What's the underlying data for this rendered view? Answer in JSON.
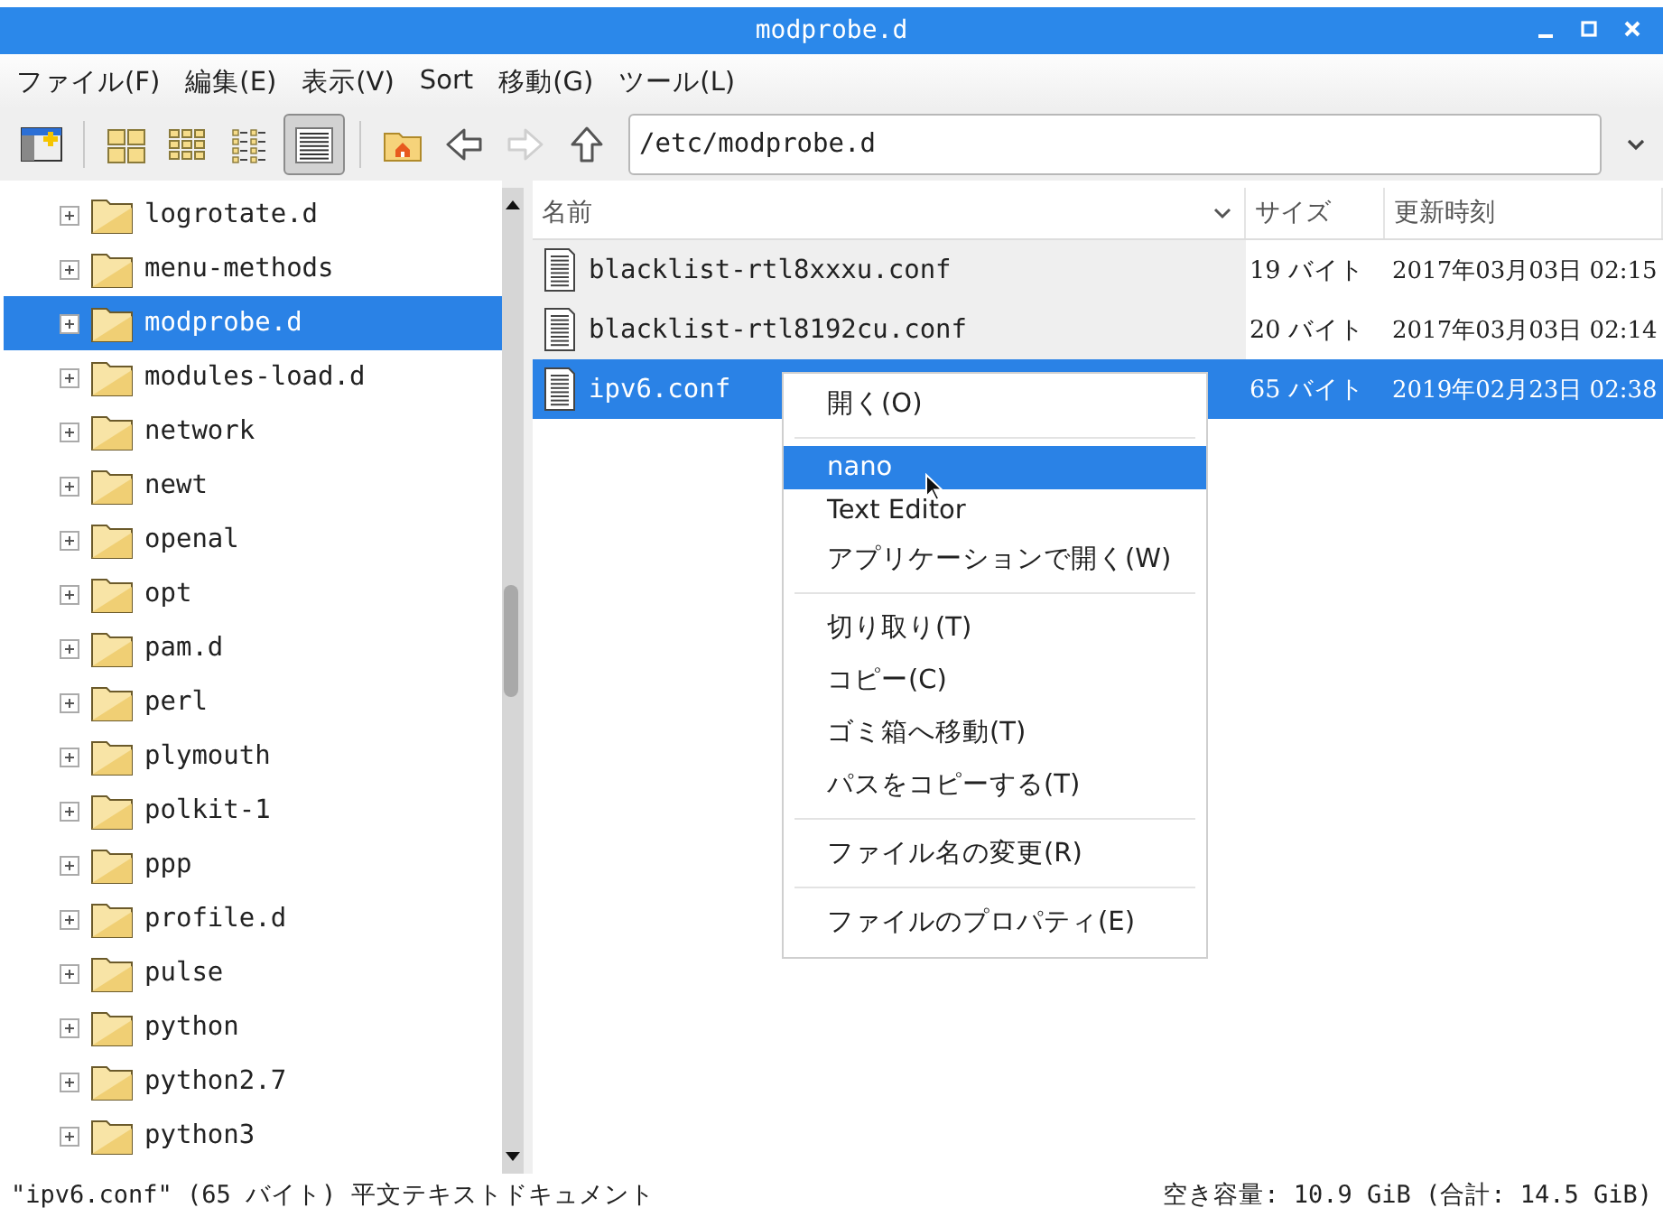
{
  "window": {
    "title": "modprobe.d"
  },
  "menu_bar": [
    "ファイル(F)",
    "編集(E)",
    "表示(V)",
    "Sort",
    "移動(G)",
    "ツール(L)"
  ],
  "toolbar": {
    "view_buttons": [
      {
        "kind": "icons",
        "selected": false
      },
      {
        "kind": "thumbnails",
        "selected": false
      },
      {
        "kind": "compact",
        "selected": false
      },
      {
        "kind": "detailed",
        "selected": true
      }
    ],
    "nav_buttons": [
      {
        "kind": "home",
        "disabled": false
      },
      {
        "kind": "back",
        "disabled": false
      },
      {
        "kind": "forward",
        "disabled": true
      },
      {
        "kind": "up",
        "disabled": false
      }
    ],
    "path": "/etc/modprobe.d"
  },
  "sidebar": {
    "items": [
      {
        "label": "logrotate.d",
        "selected": false
      },
      {
        "label": "menu-methods",
        "selected": false
      },
      {
        "label": "modprobe.d",
        "selected": true
      },
      {
        "label": "modules-load.d",
        "selected": false
      },
      {
        "label": "network",
        "selected": false
      },
      {
        "label": "newt",
        "selected": false
      },
      {
        "label": "openal",
        "selected": false
      },
      {
        "label": "opt",
        "selected": false
      },
      {
        "label": "pam.d",
        "selected": false
      },
      {
        "label": "perl",
        "selected": false
      },
      {
        "label": "plymouth",
        "selected": false
      },
      {
        "label": "polkit-1",
        "selected": false
      },
      {
        "label": "ppp",
        "selected": false
      },
      {
        "label": "profile.d",
        "selected": false
      },
      {
        "label": "pulse",
        "selected": false
      },
      {
        "label": "python",
        "selected": false
      },
      {
        "label": "python2.7",
        "selected": false
      },
      {
        "label": "python3",
        "selected": false
      }
    ]
  },
  "table": {
    "columns": [
      "名前",
      "サイズ",
      "更新時刻"
    ],
    "rows": [
      {
        "name": "blacklist-rtl8xxxu.conf",
        "size": "19 バイト",
        "modified": "2017年03月03日 02:15",
        "selected": false
      },
      {
        "name": "blacklist-rtl8192cu.conf",
        "size": "20 バイト",
        "modified": "2017年03月03日 02:14",
        "selected": false
      },
      {
        "name": "ipv6.conf",
        "size": "65 バイト",
        "modified": "2019年02月23日 02:38",
        "selected": true
      }
    ]
  },
  "context_menu": {
    "items": [
      {
        "kind": "item",
        "label": "開く(O)",
        "selected": false
      },
      {
        "kind": "separator"
      },
      {
        "kind": "item",
        "label": "nano",
        "selected": true
      },
      {
        "kind": "item",
        "label": "Text Editor",
        "selected": false
      },
      {
        "kind": "item",
        "label": "アプリケーションで開く(W)",
        "selected": false
      },
      {
        "kind": "separator"
      },
      {
        "kind": "item",
        "label": "切り取り(T)",
        "selected": false
      },
      {
        "kind": "item",
        "label": "コピー(C)",
        "selected": false
      },
      {
        "kind": "item",
        "label": "ゴミ箱へ移動(T)",
        "selected": false
      },
      {
        "kind": "item",
        "label": "パスをコピーする(T)",
        "selected": false
      },
      {
        "kind": "separator"
      },
      {
        "kind": "item",
        "label": "ファイル名の変更(R)",
        "selected": false
      },
      {
        "kind": "separator"
      },
      {
        "kind": "item",
        "label": "ファイルのプロパティ(E)",
        "selected": false
      }
    ]
  },
  "status_bar": {
    "left": "\"ipv6.conf\" (65 バイト) 平文テキストドキュメント",
    "right": "空き容量: 10.9 GiB (合計: 14.5 GiB)"
  }
}
